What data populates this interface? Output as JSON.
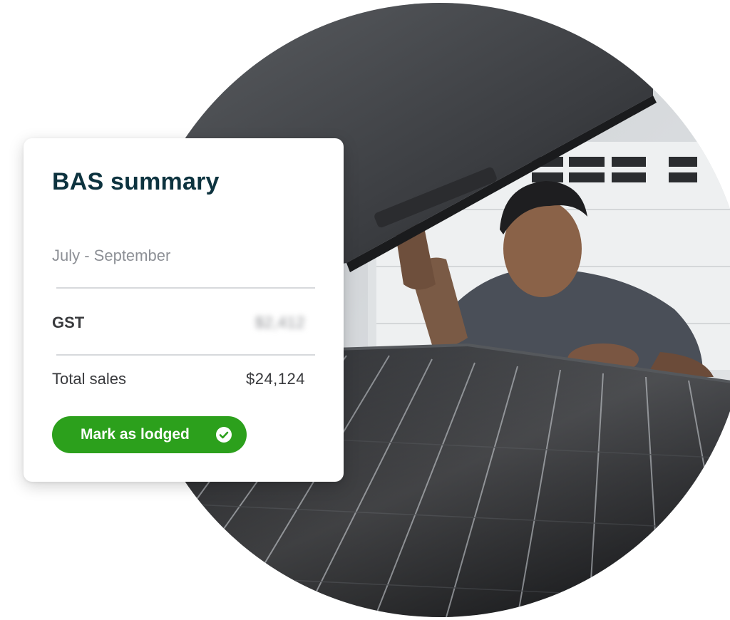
{
  "card": {
    "title": "BAS summary",
    "period": "July - September",
    "gst": {
      "label": "GST",
      "value": "$2,412",
      "value_obscured": true
    },
    "total_sales": {
      "label": "Total sales",
      "value": "$24,124"
    },
    "lodge_button": {
      "label": "Mark as lodged",
      "icon": "check-circle-icon"
    }
  },
  "colors": {
    "title": "#0d333f",
    "accent_green": "#2ca01c",
    "muted_text": "#8d9096",
    "body_text": "#393a3d"
  },
  "photo": {
    "subject": "man inspecting solar panel"
  }
}
